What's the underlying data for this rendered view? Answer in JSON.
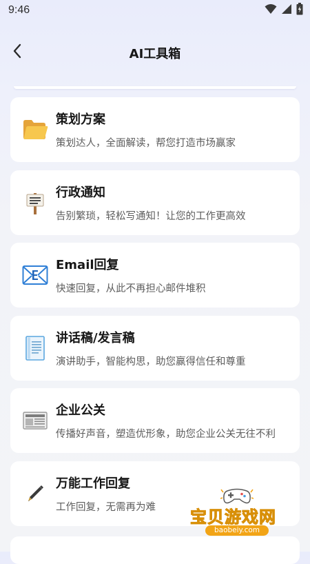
{
  "status_bar": {
    "time": "9:46",
    "icons": [
      "wifi-icon",
      "cell-signal-icon",
      "battery-charging-icon"
    ]
  },
  "header": {
    "title": "AI工具箱",
    "back_icon": "back-arrow-icon"
  },
  "tools": [
    {
      "title": "策划方案",
      "description": "策划达人，全面解读，帮您打造市场赢家",
      "icon": "folder-icon"
    },
    {
      "title": "行政通知",
      "description": "告别繁琐，轻松写通知！让您的工作更高效",
      "icon": "signpost-icon"
    },
    {
      "title": "Email回复",
      "description": "快速回复，从此不再担心邮件堆积",
      "icon": "email-icon"
    },
    {
      "title": "讲话稿/发言稿",
      "description": "演讲助手，智能构思，助您赢得信任和尊重",
      "icon": "document-icon"
    },
    {
      "title": "企业公关",
      "description": "传播好声音，塑造优形象，助您企业公关无往不利",
      "icon": "newspaper-icon"
    },
    {
      "title": "万能工作回复",
      "description": "工作回复，无需再为难",
      "icon": "pen-icon"
    }
  ],
  "watermark": {
    "name": "宝贝游戏网",
    "url": "baobeiy.com",
    "icon": "gamepad-icon"
  },
  "colors": {
    "background_top": "#e9ecfb",
    "background_bottom": "#f3f4f7",
    "card": "#ffffff",
    "title_text": "#171717",
    "desc_text": "#5d5d5d",
    "watermark": "#f3b21a"
  }
}
